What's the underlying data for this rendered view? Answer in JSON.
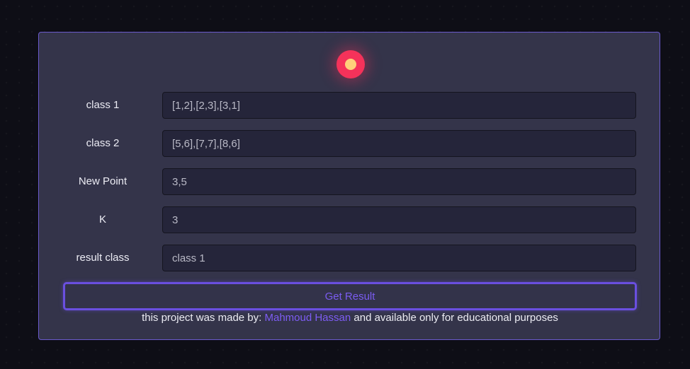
{
  "form": {
    "rows": [
      {
        "label": "class 1",
        "value": "[1,2],[2,3],[3,1]"
      },
      {
        "label": "class 2",
        "value": "[5,6],[7,7],[8,6]"
      },
      {
        "label": "New Point",
        "value": "3,5"
      },
      {
        "label": "K",
        "value": "3"
      },
      {
        "label": "result class",
        "value": "class 1"
      }
    ],
    "button_label": "Get Result"
  },
  "footer": {
    "prefix": "this project was made by:",
    "author": "Mahmoud Hassan",
    "suffix": "and available only for educational purposes"
  },
  "colors": {
    "background": "#0e0e16",
    "card": "#34344a",
    "accent": "#6a4fe0",
    "status_dot": "#f5325a",
    "status_core": "#ffd07a"
  },
  "icons": {
    "status": "status-indicator-icon"
  }
}
